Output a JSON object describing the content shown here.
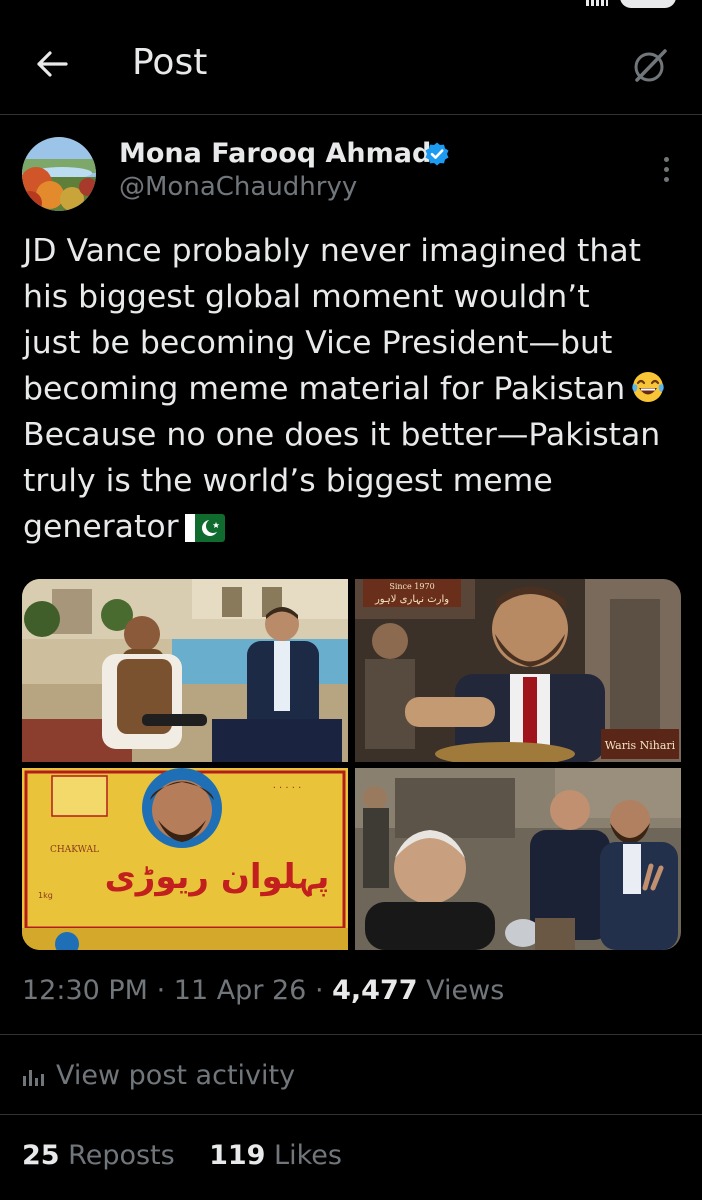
{
  "header": {
    "title": "Post"
  },
  "author": {
    "name": "Mona Farooq Ahmad",
    "handle": "@MonaChaudhryy",
    "verified": true
  },
  "post": {
    "lines": [
      "JD Vance probably never imagined that",
      "his biggest global moment wouldn’t",
      "just be becoming Vice President—but",
      "becoming meme material for Pakistan",
      "Because no one does it better—Pakistan",
      "truly is the world’s biggest meme",
      "generator"
    ],
    "emoji_line4": "face-with-tears-of-joy-icon",
    "emoji_line7": "pakistan-flag-icon"
  },
  "media": {
    "count": 4,
    "photos": [
      {
        "description_icon": "photo-interview-poolside"
      },
      {
        "description_icon": "photo-eating-nihari",
        "sign_top": "Since 1970",
        "sign_urdu": "وارث نہاری لاہور",
        "sign_corner": "Waris Nihari"
      },
      {
        "description_icon": "photo-sweets-box",
        "box_urdu": "پہلوان ریوڑی",
        "box_side": "CHAKWAL",
        "box_weight": "1kg"
      },
      {
        "description_icon": "photo-selfie-street"
      }
    ]
  },
  "meta": {
    "time": "12:30 PM",
    "date": "11 Apr 26",
    "views_count": "4,477",
    "views_label": "Views",
    "sep": "·"
  },
  "activity": {
    "label": "View post activity"
  },
  "stats": {
    "reposts_count": "25",
    "reposts_label": "Reposts",
    "likes_count": "119",
    "likes_label": "Likes"
  },
  "colors": {
    "background": "#000000",
    "text": "#e7e9ea",
    "muted": "#71767b",
    "verified": "#1d9bf0",
    "divider": "#2f3336"
  }
}
